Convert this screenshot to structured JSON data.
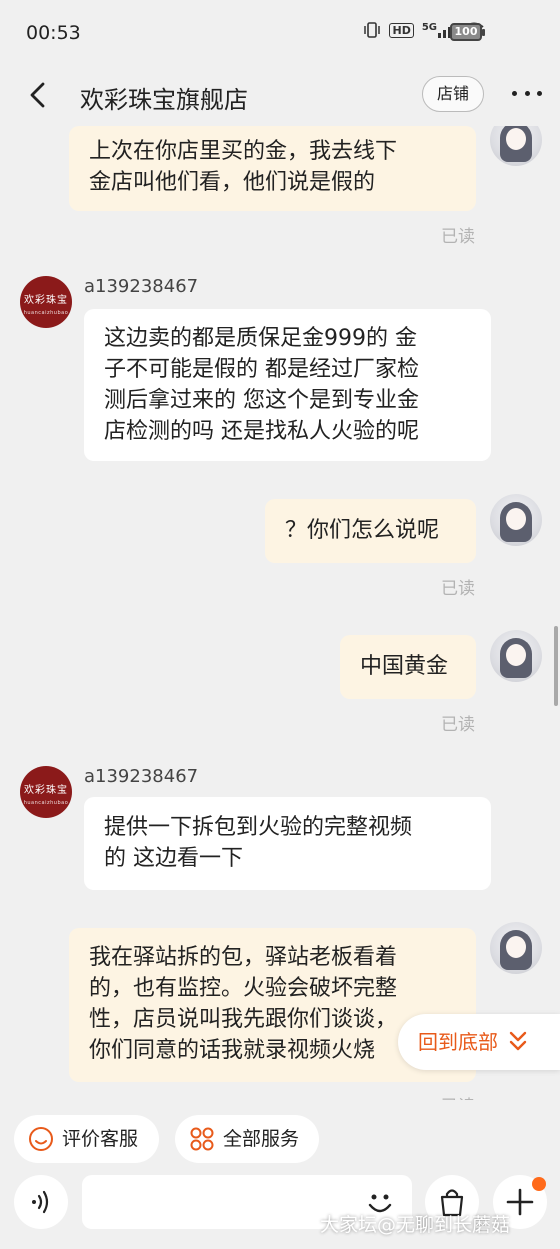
{
  "status_bar": {
    "time": "00:53",
    "hd_label": "HD",
    "network_label": "5G",
    "battery_label": "100"
  },
  "header": {
    "title": "欢彩珠宝旗舰店",
    "store_button": "店铺"
  },
  "messages": [
    {
      "from": "me",
      "lines": [
        "上次在你店里买的金，我去线下",
        "金店叫他们看，他们说是假的"
      ],
      "status": "已读"
    },
    {
      "from": "shop",
      "sender": "a139238467",
      "lines": [
        "这边卖的都是质保足金999的   金",
        "子不可能是假的  都是经过厂家检",
        "测后拿过来的 您这个是到专业金",
        "店检测的吗 还是找私人火验的呢"
      ]
    },
    {
      "from": "me",
      "lines": [
        "？你们怎么说呢"
      ],
      "status": "已读"
    },
    {
      "from": "me",
      "lines": [
        "中国黄金"
      ],
      "status": "已读"
    },
    {
      "from": "shop",
      "sender": "a139238467",
      "lines": [
        "提供一下拆包到火验的完整视频",
        "的  这边看一下"
      ]
    },
    {
      "from": "me",
      "lines": [
        "我在驿站拆的包，驿站老板看着",
        "的，也有监控。火验会破坏完整",
        "性，店员说叫我先跟你们谈谈，",
        "你们同意的话我就录视频火烧"
      ],
      "status": "已读"
    }
  ],
  "shop_avatar": {
    "logo_cn": "欢彩珠宝",
    "logo_en": "huancaizhubao"
  },
  "back_to_bottom": "回到底部",
  "quick_actions": {
    "rate_service": "评价客服",
    "all_services": "全部服务"
  },
  "input": {
    "placeholder": ""
  },
  "watermark": "大家坛@无聊到长蘑菇",
  "colors": {
    "accent": "#e85a1a",
    "my_bubble": "#fdf4e3",
    "shop_avatar": "#8b1a1a",
    "background": "#f0f0f0"
  }
}
